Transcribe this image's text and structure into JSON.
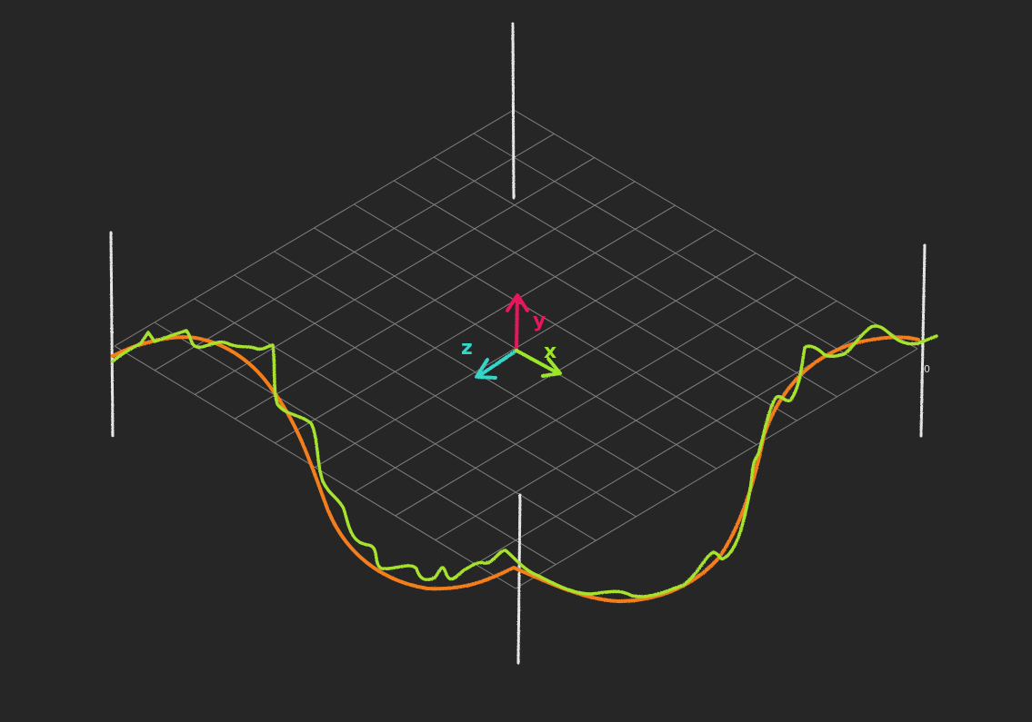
{
  "axis_labels": {
    "x": "x",
    "y": "y",
    "z": "z"
  },
  "origin_label": "0",
  "colors": {
    "background": "#262626",
    "grid": "#8a8a8a",
    "corner_posts": "#e6e6e6",
    "x_axis": "#9be62a",
    "y_axis": "#e8175d",
    "z_axis": "#35d6c8",
    "smooth_curve": "#f47e1e",
    "noisy_curve": "#a6e22e"
  },
  "grid": {
    "divisions": 10
  }
}
